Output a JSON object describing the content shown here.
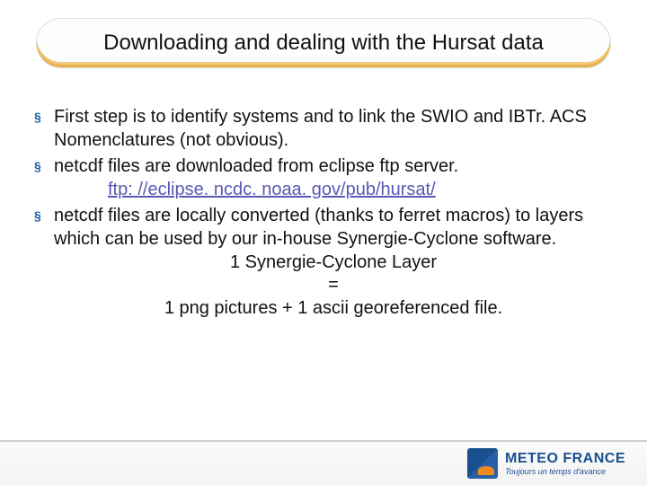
{
  "title": "Downloading and dealing with the Hursat data",
  "bullets": [
    {
      "text": "First step is to identify systems and to link the SWIO and IBTr. ACS Nomenclatures (not obvious)."
    },
    {
      "text": "netcdf files are downloaded from  eclipse ftp server.",
      "link": "ftp: //eclipse. ncdc. noaa. gov/pub/hursat/"
    },
    {
      "text": "netcdf files are locally converted (thanks to ferret macros) to layers which can be used by our in-house Synergie-Cyclone software.",
      "center_lines": [
        "1 Synergie-Cyclone Layer",
        "=",
        "1 png pictures + 1 ascii georeferenced file."
      ]
    }
  ],
  "bullet_marker": "§",
  "footer": {
    "brand": "METEO FRANCE",
    "tagline": "Toujours un temps d'avance"
  }
}
